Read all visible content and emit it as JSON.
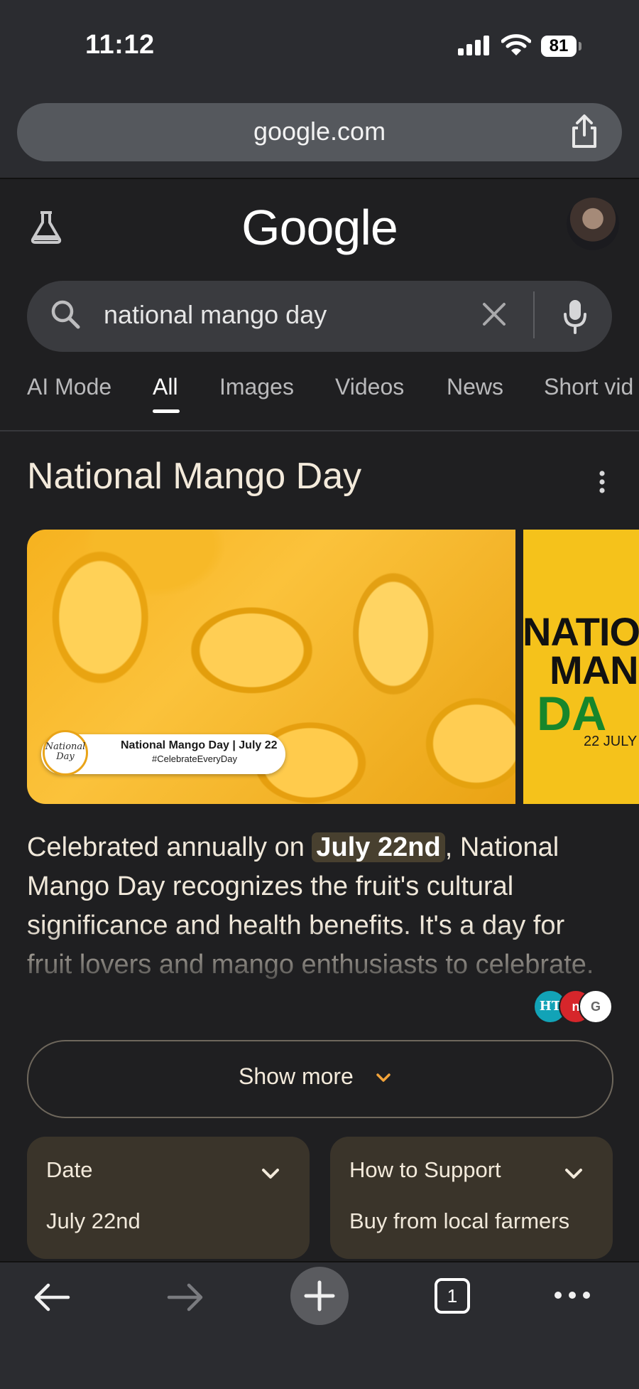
{
  "status": {
    "time": "11:12",
    "battery": "81"
  },
  "browser": {
    "url": "google.com"
  },
  "google": {
    "logo": "Google",
    "query": "national mango day"
  },
  "tabs": [
    {
      "label": "AI Mode"
    },
    {
      "label": "All"
    },
    {
      "label": "Images"
    },
    {
      "label": "Videos"
    },
    {
      "label": "News"
    },
    {
      "label": "Short vid"
    }
  ],
  "result": {
    "title": "National Mango Day",
    "image1": {
      "badge_logo": "National Day",
      "badge_title": "National Mango Day | July 22",
      "badge_tag": "#CelebrateEveryDay"
    },
    "image2": {
      "line1": "NATIO",
      "line2": "MAN",
      "line3": "DA",
      "line4": "22 JULY"
    },
    "para_pre": "Celebrated annually on ",
    "para_highlight": "July 22nd",
    "para_post": ", National Mango Day recognizes the fruit's cultural significance and health benefits. It's a day for fruit lovers and mango enthusiasts to celebrate.",
    "sources": [
      "HT",
      "n",
      "G"
    ],
    "show_more": "Show more",
    "cards": [
      {
        "heading": "Date",
        "value": "July 22nd"
      },
      {
        "heading": "How to Support",
        "value": "Buy from local farmers"
      }
    ]
  },
  "bottom": {
    "tab_count": "1"
  },
  "colors": {
    "highlight": "#48402f",
    "accent_chevron": "#f2a33a",
    "mango": "#f6b21f"
  },
  "icons": [
    "signal-icon",
    "wifi-icon",
    "share-icon",
    "flask-icon",
    "search-icon",
    "clear-icon",
    "mic-icon",
    "kebab-icon",
    "chevron-down-icon",
    "back-icon",
    "forward-icon",
    "plus-icon",
    "tabs-icon",
    "more-icon"
  ]
}
